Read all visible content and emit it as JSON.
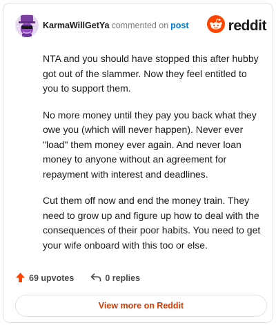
{
  "comment": {
    "username": "KarmaWillGetYa",
    "action": "commented on",
    "post_link": "post"
  },
  "brand": {
    "wordmark": "reddit",
    "icon": "reddit-snoo-icon",
    "color": "#ff4500"
  },
  "body": {
    "paragraphs": [
      "NTA and you should have stopped this after hubby got out of the slammer. Now they feel entitled to you to support them.",
      "No more money until they pay you back what they owe you (which will never happen). Never ever \"load\" them money ever again. And never loan money to anyone without an agreement for repayment with interest and deadlines.",
      "Cut them off now and end the money train. They need to grow up and figure up how to deal with the consequences of their poor habits. You need to get your wife onboard with this too or else."
    ]
  },
  "footer": {
    "upvotes": "69 upvotes",
    "upvote_icon": "upvote-arrow-icon",
    "upvote_color": "#ff4500",
    "replies": "0 replies",
    "reply_icon": "reply-arrow-icon"
  },
  "cta": {
    "label": "View more on Reddit",
    "color": "#d93a00"
  }
}
